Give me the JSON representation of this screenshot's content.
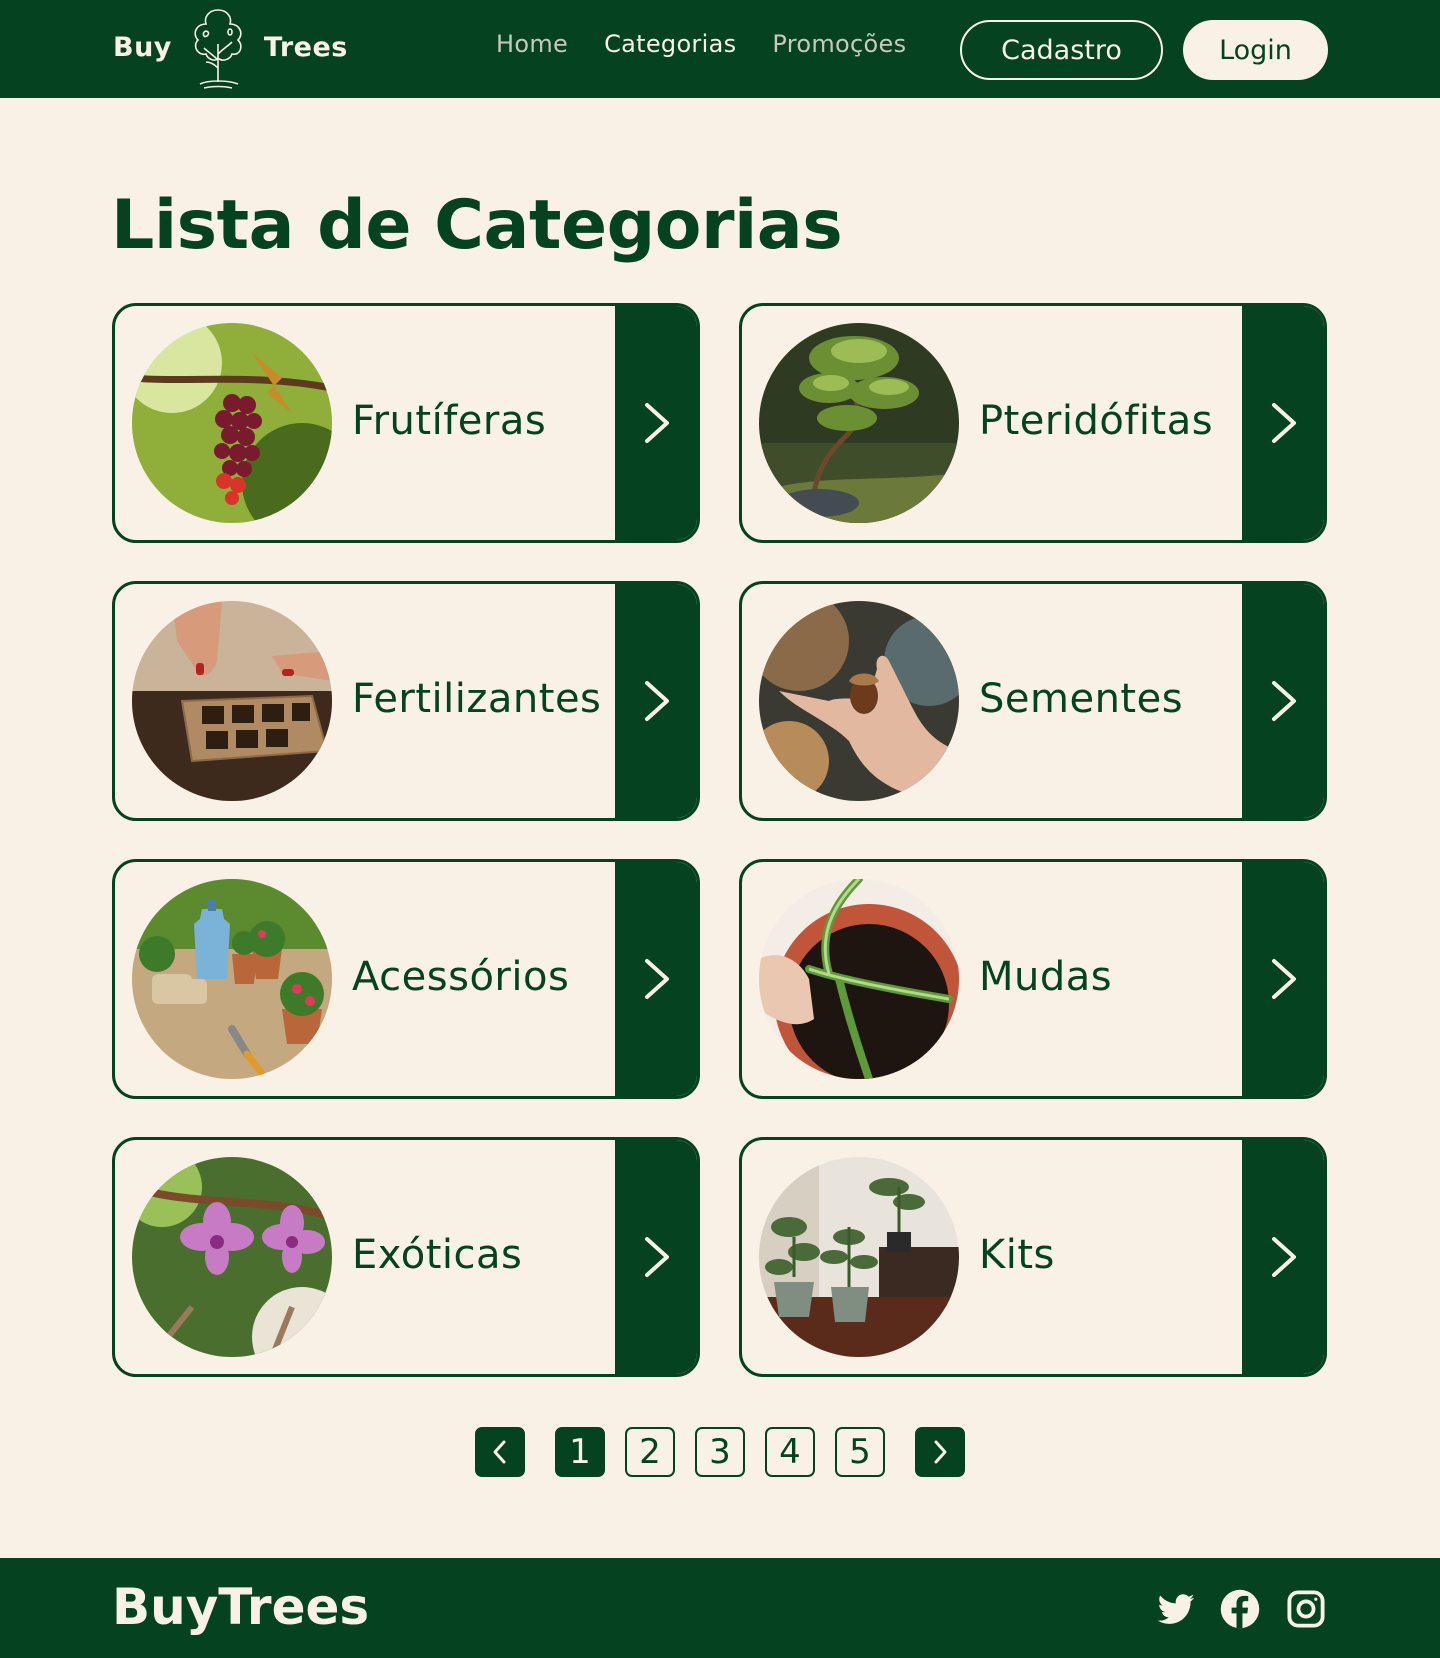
{
  "brand": {
    "logo_left": "Buy",
    "logo_right": "Trees",
    "footer_name": "BuyTrees"
  },
  "nav": {
    "items": [
      {
        "label": "Home",
        "active": false
      },
      {
        "label": "Categorias",
        "active": true
      },
      {
        "label": "Promoções",
        "active": false
      }
    ],
    "signup_label": "Cadastro",
    "login_label": "Login"
  },
  "main": {
    "title": "Lista de Categorias",
    "categories": [
      {
        "label": "Frutíferas",
        "image": "grapes"
      },
      {
        "label": "Pteridófitas",
        "image": "bonsai"
      },
      {
        "label": "Fertilizantes",
        "image": "seed-tray"
      },
      {
        "label": "Sementes",
        "image": "acorn-in-hand"
      },
      {
        "label": "Acessórios",
        "image": "garden-tools"
      },
      {
        "label": "Mudas",
        "image": "seedling-pot"
      },
      {
        "label": "Exóticas",
        "image": "orchid"
      },
      {
        "label": "Kits",
        "image": "potted-plants"
      }
    ]
  },
  "pagination": {
    "pages": [
      "1",
      "2",
      "3",
      "4",
      "5"
    ],
    "current": "1"
  },
  "social": [
    "twitter-icon",
    "facebook-icon",
    "instagram-icon"
  ],
  "colors": {
    "primary": "#05421f",
    "background": "#f9f0e6"
  }
}
